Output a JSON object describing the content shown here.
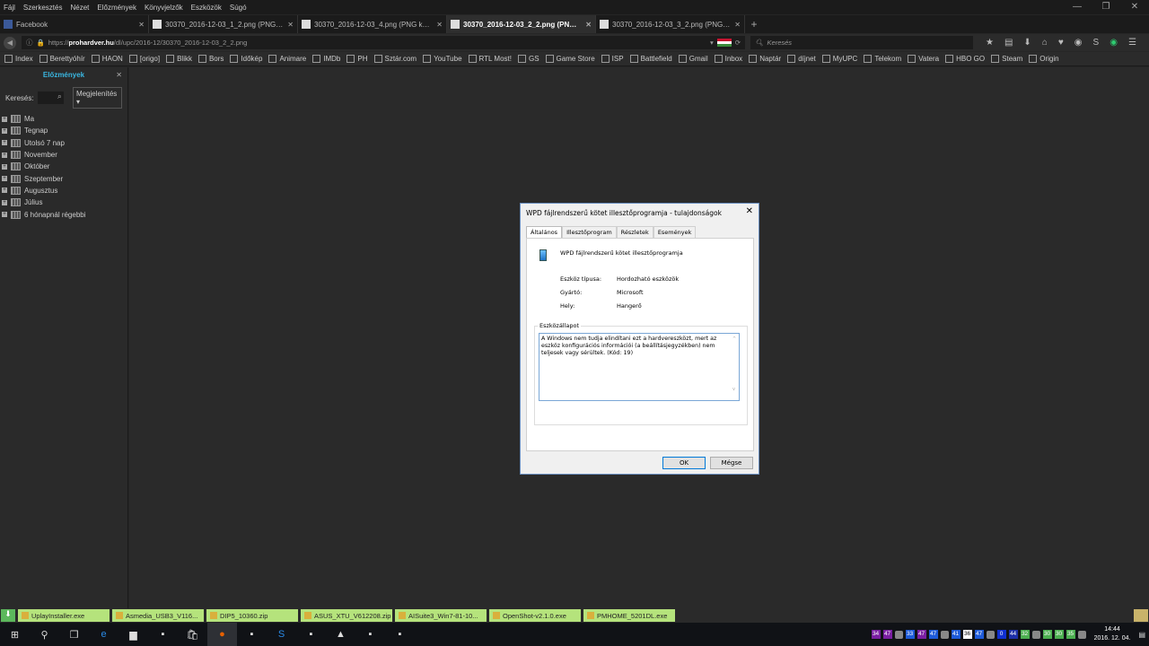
{
  "menu": [
    "Fájl",
    "Szerkesztés",
    "Nézet",
    "Előzmények",
    "Könyvjelzők",
    "Eszközök",
    "Súgó"
  ],
  "window_controls": [
    "—",
    "❐",
    "✕"
  ],
  "tabs": [
    {
      "label": "Facebook",
      "active": false
    },
    {
      "label": "30370_2016-12-03_1_2.png (PNG ké...",
      "active": false
    },
    {
      "label": "30370_2016-12-03_4.png (PNG kép, ...",
      "active": false
    },
    {
      "label": "30370_2016-12-03_2_2.png (PNG ké...",
      "active": true
    },
    {
      "label": "30370_2016-12-03_3_2.png (PNG ké...",
      "active": false
    }
  ],
  "newtab": "+",
  "url": {
    "prefix": "https://",
    "domain": "prohardver.hu",
    "path": "/dl/upc/2016-12/30370_2016-12-03_2_2.png"
  },
  "search_placeholder": "Keresés",
  "bookmarks": [
    "Index",
    "Berettyóhír",
    "HAON",
    "[origo]",
    "Blikk",
    "Bors",
    "Időkép",
    "Animare",
    "IMDb",
    "PH",
    "Sztár.com",
    "YouTube",
    "RTL Most!",
    "GS",
    "Game Store",
    "ISP",
    "Battlefield",
    "Gmail",
    "Inbox",
    "Naptár",
    "díjnet",
    "MyUPC",
    "Telekom",
    "Vatera",
    "HBO GO",
    "Steam",
    "Origin"
  ],
  "sidebar": {
    "title": "Előzmények",
    "search_label": "Keresés:",
    "view_label": "Megjelenítés ▾",
    "items": [
      "Ma",
      "Tegnap",
      "Utolsó 7 nap",
      "November",
      "Október",
      "Szeptember",
      "Augusztus",
      "Július",
      "6 hónapnál régebbi"
    ]
  },
  "dialog": {
    "title": "WPD fájlrendszerű kötet illesztőprogramja - tulajdonságok",
    "tabs": [
      "Általános",
      "Illesztőprogram",
      "Részletek",
      "Események"
    ],
    "device_name": "WPD fájlrendszerű kötet illesztőprogramja",
    "props": [
      {
        "label": "Eszköz típusa:",
        "value": "Hordozható eszközök"
      },
      {
        "label": "Gyártó:",
        "value": "Microsoft"
      },
      {
        "label": "Hely:",
        "value": "Hangerő"
      }
    ],
    "status_label": "Eszközállapot",
    "status_text": "A Windows nem tudja elindítani ezt a hardvereszközt, mert az eszköz konfigurációs információi (a beállításjegyzékben) nem teljesek vagy sérültek. (Kód: 19)",
    "ok": "OK",
    "cancel": "Mégse"
  },
  "downloads": [
    "UplayInstaller.exe",
    "Asmedia_USB3_V116...",
    "DIP5_10360.zip",
    "ASUS_XTU_V612208.zip",
    "AISuite3_Win7-81-10...",
    "OpenShot-v2.1.0.exe",
    "PMHOME_5201DL.exe"
  ],
  "taskbar_icons": [
    "windows-start",
    "search",
    "task-view",
    "edge",
    "file-explorer",
    "app",
    "store",
    "firefox",
    "app",
    "skype",
    "app",
    "photos",
    "app",
    "app"
  ],
  "tray_numbers": [
    {
      "v": "34",
      "c": "#7a1fa2"
    },
    {
      "v": "47",
      "c": "#7a1fa2"
    },
    {
      "v": "33",
      "c": "#1e5bd8"
    },
    {
      "v": "47",
      "c": "#7a1fa2"
    },
    {
      "v": "47",
      "c": "#1e5bd8"
    },
    {
      "v": "41",
      "c": "#1e5bd8"
    },
    {
      "v": "36",
      "c": "#ffffff"
    },
    {
      "v": "47",
      "c": "#1e5bd8"
    },
    {
      "v": "0",
      "c": "#1030d0"
    },
    {
      "v": "44",
      "c": "#1e30a8"
    },
    {
      "v": "32",
      "c": "#4caf50"
    },
    {
      "v": "30",
      "c": "#4caf50"
    },
    {
      "v": "30",
      "c": "#4caf50"
    },
    {
      "v": "35",
      "c": "#4caf50"
    }
  ],
  "clock": {
    "time": "14:44",
    "date": "2016. 12. 04."
  }
}
